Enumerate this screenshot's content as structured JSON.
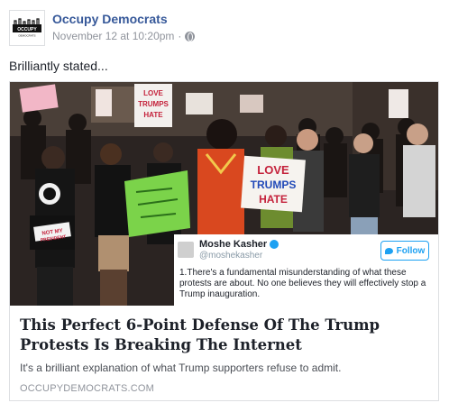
{
  "post": {
    "page_name": "Occupy Democrats",
    "timestamp": "November 12 at 10:20pm",
    "separator": "·",
    "privacy_icon": "globe-icon",
    "avatar_text": "OCCUPY",
    "avatar_subtext": "DEMOCRATS",
    "text": "Brilliantly stated..."
  },
  "link": {
    "title": "This Perfect 6-Point Defense Of The Trump Protests Is Breaking The Internet",
    "description": "It's a brilliant explanation of what Trump supporters refuse to admit.",
    "domain": "OCCUPYDEMOCRATS.COM"
  },
  "photo": {
    "signs": {
      "love_trumps_hate_left": "LOVE TRUMPS HATE",
      "love_trumps_hate_right": "LOVE TRUMPS HATE",
      "not_my_president": "NOT MY PRESIDENT"
    },
    "tweet": {
      "name": "Moshe Kasher",
      "handle": "@moshekasher",
      "follow_label": "Follow",
      "text": "1.There's a fundamental misunderstanding of what these protests are about. No one believes they will effectively stop a Trump inauguration."
    }
  },
  "colors": {
    "link_blue": "#365899",
    "meta_gray": "#90949c",
    "twitter_blue": "#1da1f2"
  }
}
